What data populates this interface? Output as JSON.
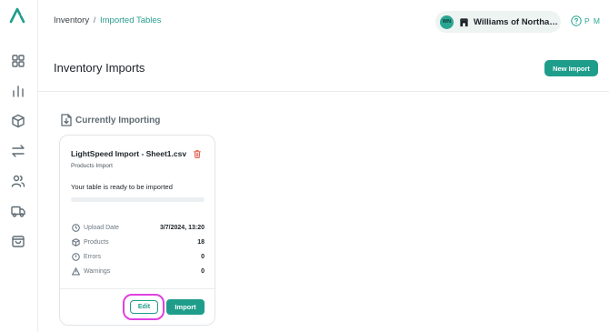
{
  "breadcrumb": {
    "parent": "Inventory",
    "separator": "/",
    "current": "Imported Tables"
  },
  "store": {
    "initials": "WN",
    "name": "Williams of Northam...",
    "icon": "store-icon"
  },
  "help": {
    "label": "P M",
    "icon": "help-circle-icon"
  },
  "sidebar": {
    "items": [
      {
        "name": "dashboard",
        "icon": "grid-icon"
      },
      {
        "name": "reports",
        "icon": "bar-chart-icon"
      },
      {
        "name": "products",
        "icon": "box-icon"
      },
      {
        "name": "transfers",
        "icon": "arrows-swap-icon"
      },
      {
        "name": "customers",
        "icon": "users-icon"
      },
      {
        "name": "shipping",
        "icon": "truck-icon"
      },
      {
        "name": "orders",
        "icon": "shopping-bag-icon"
      }
    ]
  },
  "page": {
    "title": "Inventory Imports",
    "new_import_label": "New Import"
  },
  "section": {
    "title": "Currently Importing"
  },
  "import_card": {
    "title": "LightSpeed Import - Sheet1.csv",
    "subtitle": "Products Import",
    "status": "Your table is ready to be imported",
    "progress": 0,
    "stats": [
      {
        "label": "Upload Date",
        "value": "3/7/2024, 13:20",
        "icon": "clock-icon"
      },
      {
        "label": "Products",
        "value": "18",
        "icon": "box-icon"
      },
      {
        "label": "Errors",
        "value": "0",
        "icon": "alert-circle-icon"
      },
      {
        "label": "Warnings",
        "value": "0",
        "icon": "warning-triangle-icon"
      }
    ],
    "edit_label": "Edit",
    "import_label": "Import"
  },
  "colors": {
    "accent": "#1f9d8b",
    "highlight": "#e040e0"
  }
}
